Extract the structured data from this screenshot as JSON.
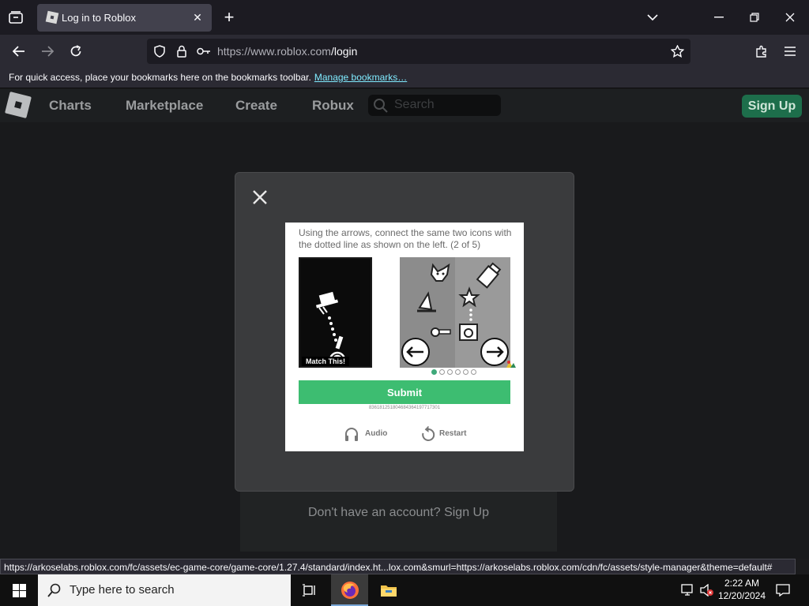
{
  "browser": {
    "tab_title": "Log in to Roblox",
    "url_host": "https://www.roblox.com",
    "url_path": "/login",
    "bookmarks_hint": "For quick access, place your bookmarks here on the bookmarks toolbar.",
    "bookmarks_link": "Manage bookmarks…",
    "status_url": "https://arkoselabs.roblox.com/fc/assets/ec-game-core/game-core/1.27.4/standard/index.ht...lox.com&smurl=https://arkoselabs.roblox.com/cdn/fc/assets/style-manager&theme=default#"
  },
  "roblox": {
    "nav": [
      "Charts",
      "Marketplace",
      "Create",
      "Robux"
    ],
    "search_placeholder": "Search",
    "signup_label": "Sign Up",
    "no_account_text": "Don't have an account? Sign Up"
  },
  "captcha": {
    "instruction": "Using the arrows, connect the same two icons with the dotted line as shown on the left. (2 of 5)",
    "match_label": "Match This!",
    "submit_label": "Submit",
    "session_id": "836181251804684364197717301",
    "audio_label": "Audio",
    "restart_label": "Restart",
    "progress": {
      "current": 1,
      "total": 6
    }
  },
  "taskbar": {
    "search_placeholder": "Type here to search",
    "time": "2:22 AM",
    "date": "12/20/2024"
  },
  "colors": {
    "accent_green": "#3dbd71",
    "link_cyan": "#80ebff"
  }
}
